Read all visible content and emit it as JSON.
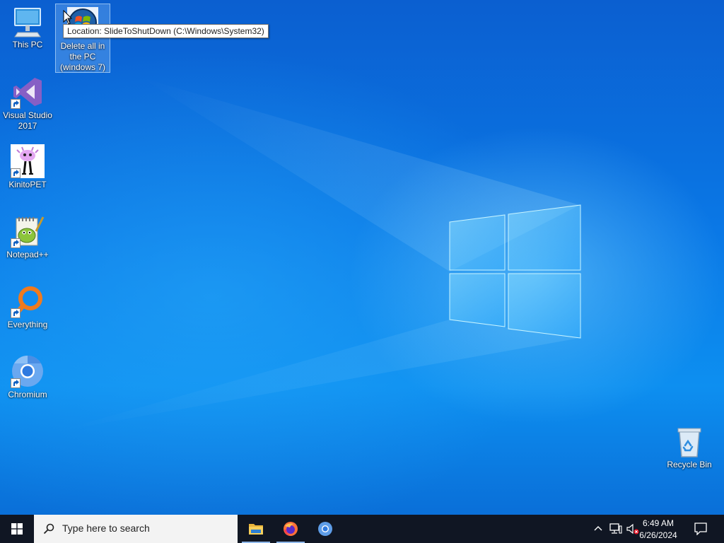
{
  "desktop_icons": [
    {
      "label": "This PC",
      "icon": "computer-icon",
      "shortcut": false
    },
    {
      "label": "Delete all in the PC (windows 7)",
      "label_lines": [
        "Delete all in",
        "the PC",
        "(windows 7)"
      ],
      "icon": "windows7-orb-icon",
      "shortcut": false,
      "selected": true
    },
    {
      "label": "Visual Studio 2017",
      "label_lines": [
        "Visual Studio",
        "2017"
      ],
      "icon": "visual-studio-icon",
      "shortcut": true
    },
    {
      "label": "KinitoPET",
      "icon": "kinitopet-icon",
      "shortcut": true
    },
    {
      "label": "Notepad++",
      "icon": "notepad-plus-plus-icon",
      "shortcut": true
    },
    {
      "label": "Everything",
      "icon": "everything-search-icon",
      "shortcut": true
    },
    {
      "label": "Chromium",
      "icon": "chromium-icon",
      "shortcut": true
    },
    {
      "label": "Recycle Bin",
      "icon": "recycle-bin-icon",
      "shortcut": false
    }
  ],
  "tooltip": {
    "text": "Location: SlideToShutDown (C:\\Windows\\System32)"
  },
  "taskbar": {
    "search": {
      "placeholder": "Type here to search"
    },
    "pinned_apps": [
      {
        "name": "File Explorer",
        "icon": "file-explorer-icon",
        "running": true
      },
      {
        "name": "Firefox",
        "icon": "firefox-icon",
        "running": true
      },
      {
        "name": "Chromium",
        "icon": "chromium-icon",
        "running": false
      }
    ],
    "tray": {
      "time": "6:49 AM",
      "date": "6/26/2024",
      "icons": [
        "chevron-up-icon",
        "network-icon",
        "volume-muted-icon",
        "notifications-icon"
      ]
    }
  },
  "colors": {
    "taskbar": "#101623",
    "wallpaper_blue": "#0a78e6",
    "search_box": "#f3f3f3"
  }
}
